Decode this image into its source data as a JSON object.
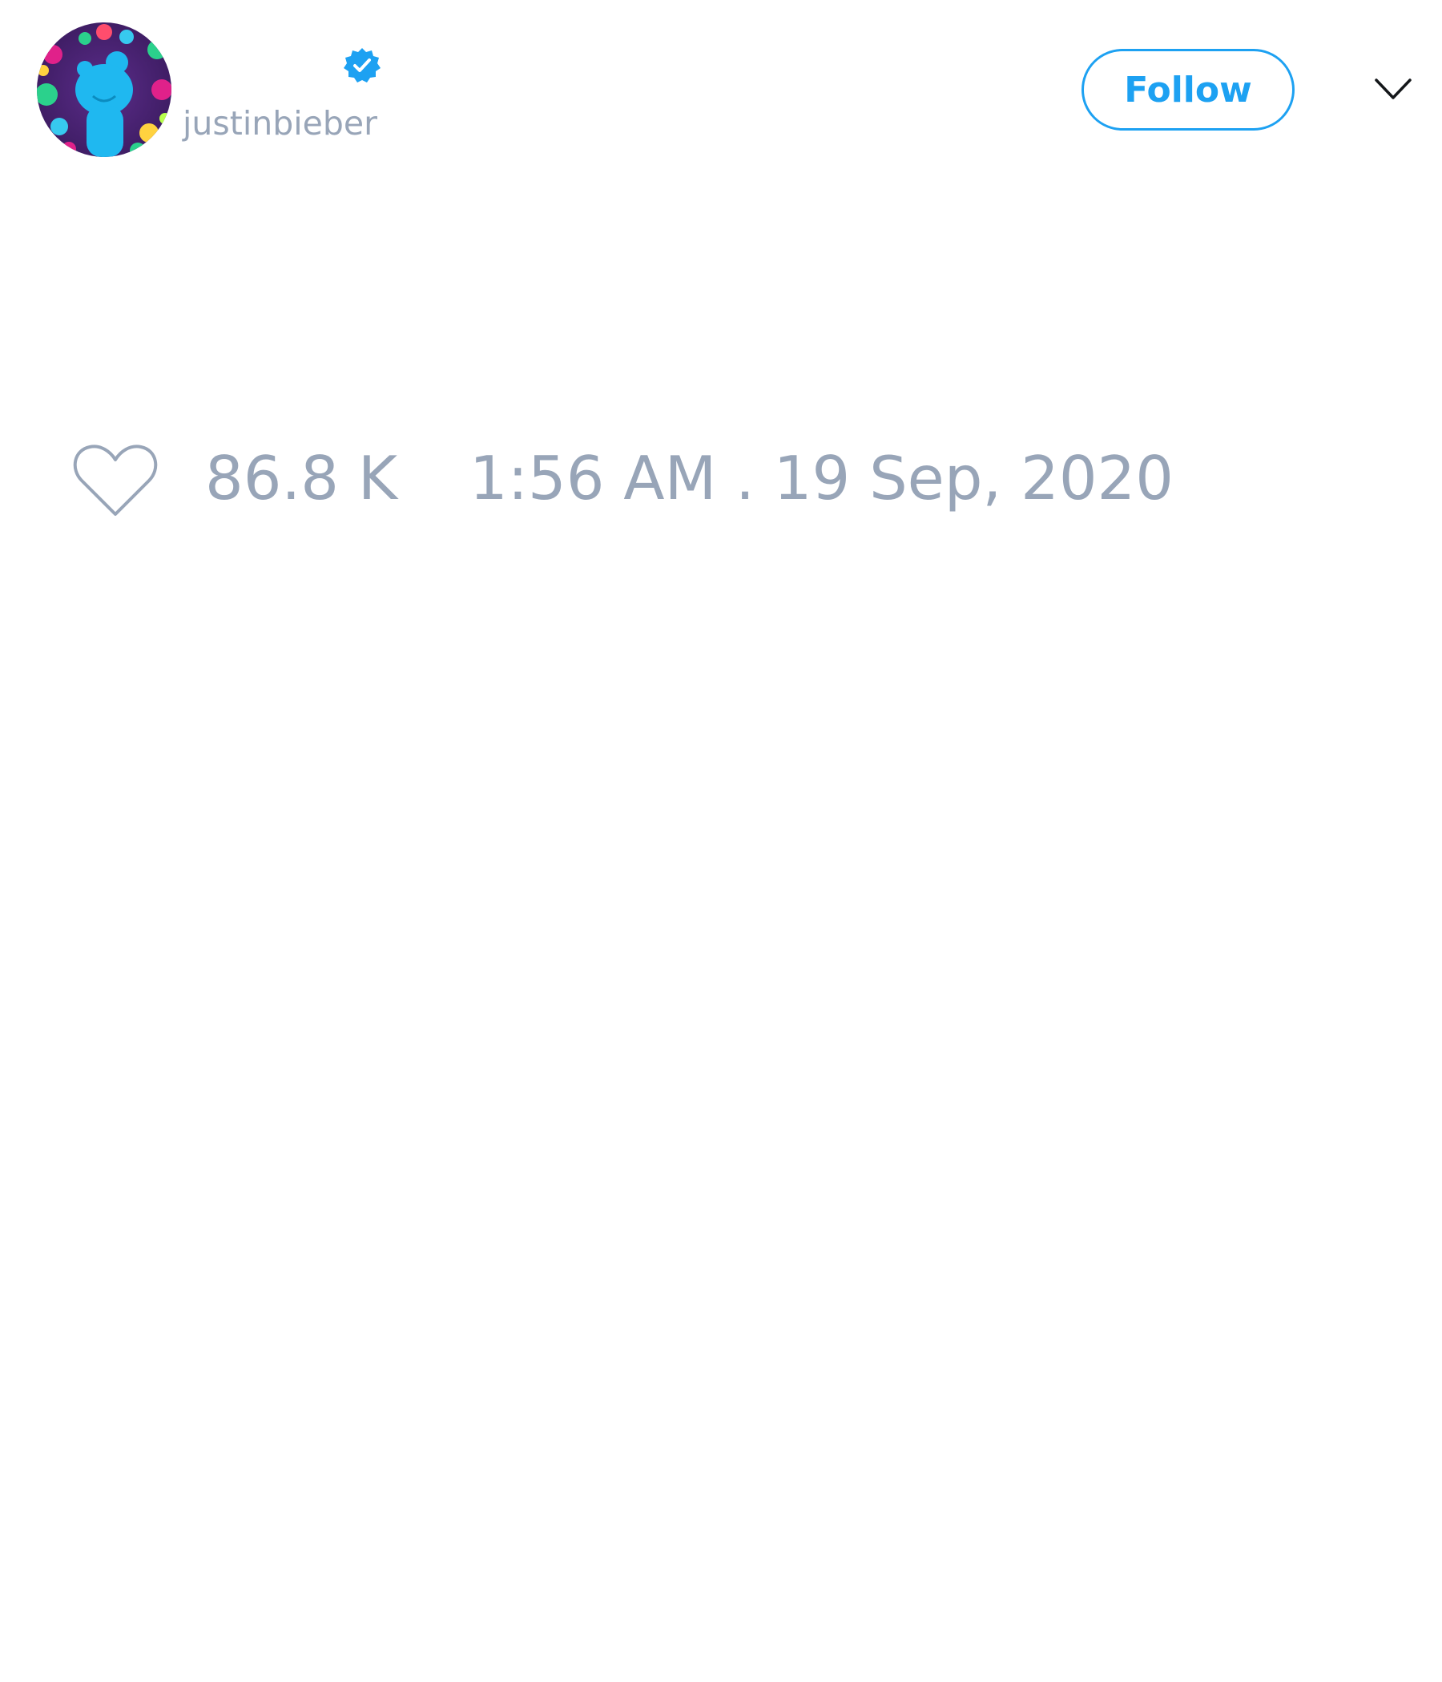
{
  "user": {
    "display_name": "",
    "handle": "justinbieber",
    "verified": true,
    "avatar_icon": "cartoon-avatar-icon"
  },
  "actions": {
    "follow_label": "Follow",
    "more_icon": "chevron-down-icon"
  },
  "stats": {
    "like_icon": "heart-outline-icon",
    "likes": "86.8 K",
    "timestamp": "1:56 AM . 19 Sep, 2020"
  },
  "colors": {
    "accent": "#1da1f2",
    "muted_text": "#98a5b8",
    "background": "#ffffff"
  }
}
